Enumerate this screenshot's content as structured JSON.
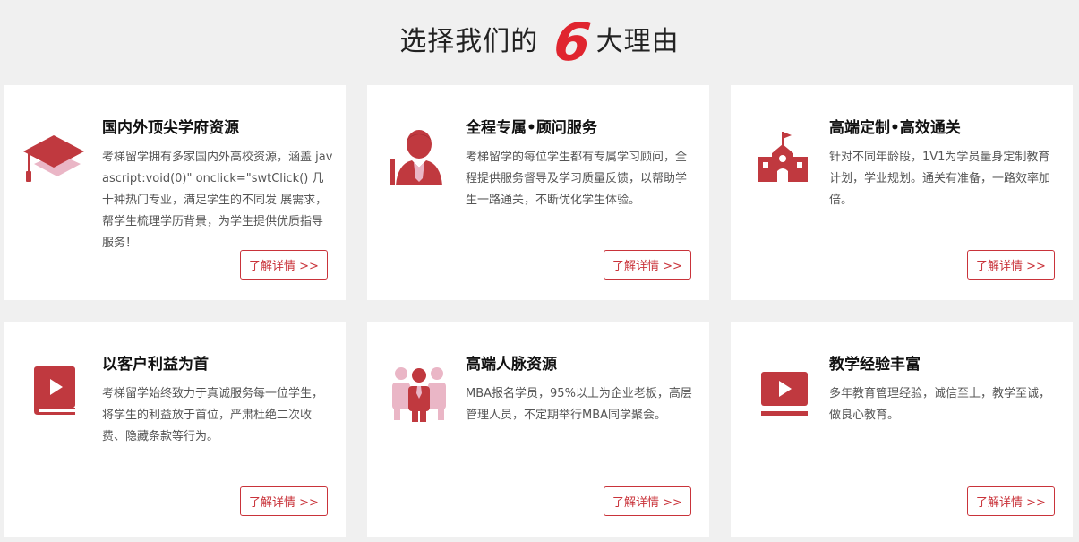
{
  "heading": {
    "prefix": "选择我们的",
    "number": "6",
    "suffix": "大理由"
  },
  "colors": {
    "accent": "#e0252f",
    "icon_red": "#c0393f",
    "icon_pink": "#eab6c6",
    "button_border": "#c9333a"
  },
  "cards": [
    {
      "icon": "graduation-cap-icon",
      "title": "国内外顶尖学府资源",
      "desc": "考梯留学拥有多家国内外高校资源，涵盖 javascript:void(0)\" onclick=\"swtClick() 几十种热门专业，满足学生的不同发 展需求，帮学生梳理学历背景，为学生提供优质指导服务！",
      "button": "了解详情 >>"
    },
    {
      "icon": "advisor-person-icon",
      "title": "全程专属•顾问服务",
      "desc": "考梯留学的每位学生都有专属学习顾问，全程提供服务督导及学习质量反馈，以帮助学生一路通关，不断优化学生体验。",
      "button": "了解详情 >>"
    },
    {
      "icon": "school-building-icon",
      "title": "高端定制•高效通关",
      "desc": "针对不同年龄段，1V1为学员量身定制教育计划，学业规划。通关有准备，一路效率加倍。",
      "button": "了解详情 >>"
    },
    {
      "icon": "video-book-icon",
      "title": "以客户利益为首",
      "desc": "考梯留学始终致力于真诚服务每一位学生，将学生的利益放于首位，严肃杜绝二次收费、隐藏条款等行为。",
      "button": "了解详情 >>"
    },
    {
      "icon": "people-network-icon",
      "title": "高端人脉资源",
      "desc": "MBA报名学员，95%以上为企业老板，高层管理人员，不定期举行MBA同学聚会。",
      "button": "了解详情 >>"
    },
    {
      "icon": "video-player-icon",
      "title": "教学经验丰富",
      "desc": "多年教育管理经验，诚信至上，教学至诚，做良心教育。",
      "button": "了解详情 >>"
    }
  ]
}
